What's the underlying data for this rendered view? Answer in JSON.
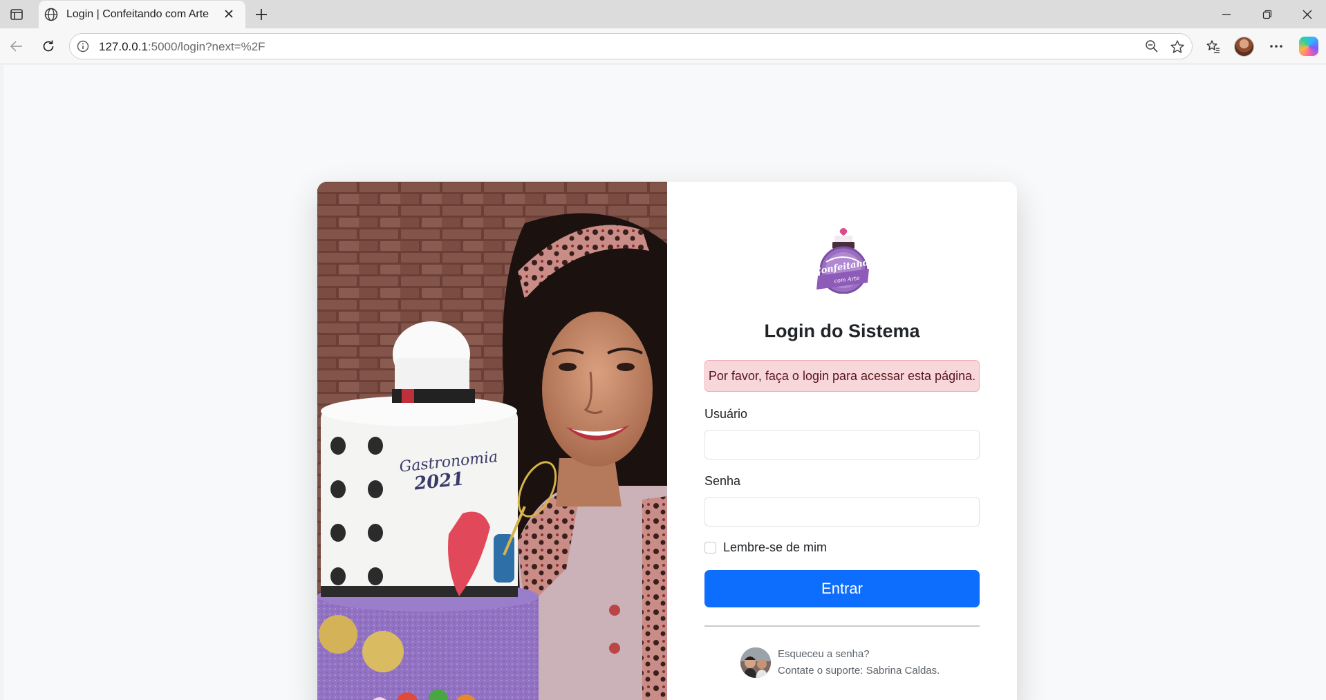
{
  "browser": {
    "tab_title": "Login | Confeitando com Arte",
    "url_host": "127.0.0.1",
    "url_rest": ":5000/login?next=%2F"
  },
  "login": {
    "title": "Login do Sistema",
    "alert": "Por favor, faça o login para acessar esta página.",
    "username_label": "Usuário",
    "username_value": "",
    "password_label": "Senha",
    "password_value": "",
    "remember_label": "Lembre-se de mim",
    "submit_label": "Entrar",
    "forgot_text": "Esqueceu a senha?",
    "support_text": "Contate o suporte: Sabrina Caldas."
  },
  "photo": {
    "cake_text_line1": "Gastronomia",
    "cake_text_line2": "2021"
  },
  "logo": {
    "text_line1": "Confeitando",
    "text_line2": "com Arte"
  },
  "colors": {
    "primary": "#0d6efd",
    "alert_bg": "#f8d7da",
    "alert_text": "#58151c",
    "logo_purple": "#9b6fc0"
  }
}
